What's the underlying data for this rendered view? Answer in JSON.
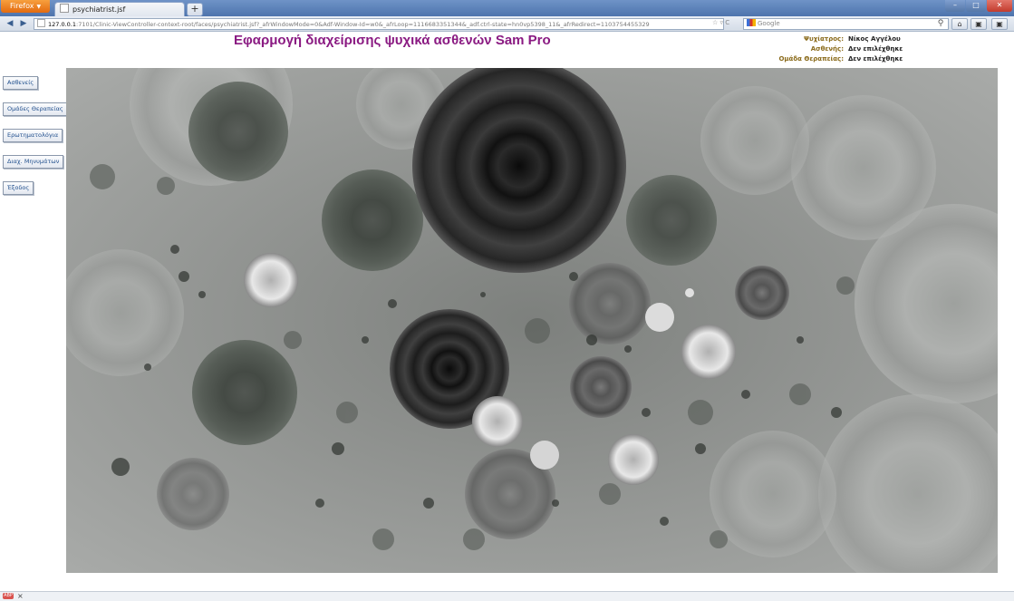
{
  "browser": {
    "menu_button": "Firefox",
    "tab_title": "psychiatrist.jsf",
    "new_tab": "+",
    "url_host": "127.0.0.1",
    "url_rest": ":7101/Clinic-ViewController-context-root/faces/psychiatrist.jsf?_afrWindowMode=0&Adf-Window-Id=w0&_afrLoop=1116683351344&_adf.ctrl-state=hn0vp5398_11&_afrRedirect=1103754455329",
    "search_placeholder": "Google"
  },
  "header": {
    "title": "Εφαρμογή διαχείρισης ψυχικά ασθενών Sam Pro",
    "info": [
      {
        "label": "Ψυχίατρος:",
        "value": "Νίκος Αγγέλου"
      },
      {
        "label": "Ασθενής:",
        "value": "Δεν επιλέχθηκε"
      },
      {
        "label": "Ομάδα Θεραπείας:",
        "value": "Δεν επιλέχθηκε"
      }
    ]
  },
  "menu": {
    "items": [
      {
        "label": "Ασθενείς"
      },
      {
        "label": "Ομάδες Θεραπείας"
      },
      {
        "label": "Ερωτηματολόγια"
      },
      {
        "label": "Διαχ. Μηνυμάτων"
      },
      {
        "label": "Έξοδος"
      }
    ]
  },
  "colors": {
    "title": "#8a1a82",
    "info_label": "#8a6a1a",
    "menu_text": "#1f4e8c"
  }
}
